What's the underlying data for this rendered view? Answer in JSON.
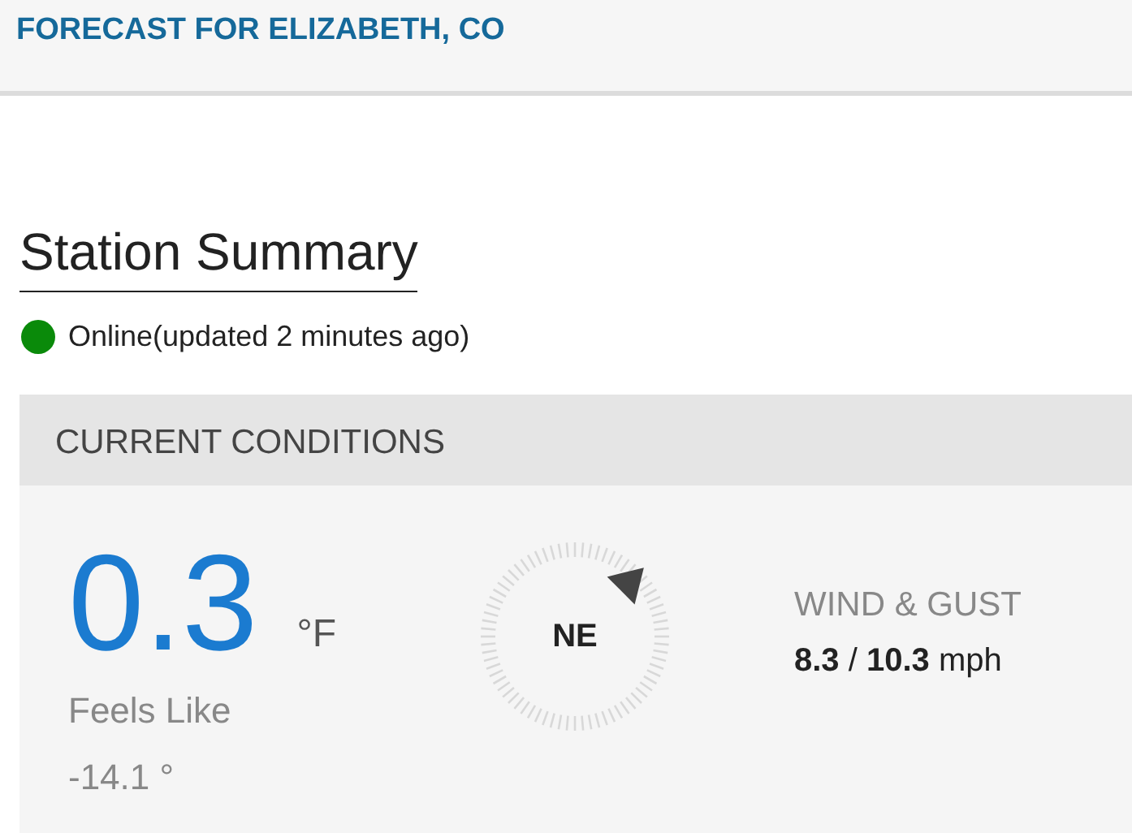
{
  "header": {
    "title": "FORECAST FOR ELIZABETH, CO"
  },
  "station": {
    "title": "Station Summary",
    "online": true,
    "status": "Online(updated 2 minutes ago)"
  },
  "conditions": {
    "heading": "CURRENT CONDITIONS",
    "temperature": "0.3",
    "unit": "°F",
    "feels_like_label": "Feels Like",
    "feels_like": "-14.1 °",
    "wind_direction": "NE",
    "wind_label": "WIND & GUST",
    "wind": "**8.3**  / **10.3** mph"
  }
}
